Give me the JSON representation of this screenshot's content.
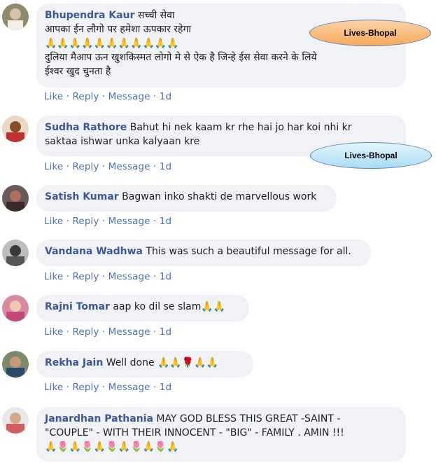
{
  "actions": {
    "like": "Like",
    "reply": "Reply",
    "message": "Message",
    "sep": "·"
  },
  "watermarks": [
    "Lives-Bhopal",
    "Lives-Bhopal"
  ],
  "comments": [
    {
      "name": "Bhupendra Kaur",
      "lines": [
        "सच्ची सेवा",
        "आपका ईन लौगो पर हमेशा ऊपकार रहेगा",
        "🙏🙏🙏🙏🙏🙏🙏🙏🙏🙏🙏",
        "दुलिया मैआप ऊन खुशकिस्मत लोगो मे से ऐक है जिन्हे ईस सेवा करने के लिये",
        "ईश्वर खुद चुनता है"
      ],
      "time": "1d"
    },
    {
      "name": "Sudha Rathore",
      "lines": [
        "Bahut hi nek kaam kr rhe hai jo har koi nhi kr",
        "saktaa ishwar unka kalyaan kre"
      ],
      "time": "1d"
    },
    {
      "name": "Satish Kumar",
      "lines": [
        "Bagwan inko shakti de marvellous work"
      ],
      "time": "1d"
    },
    {
      "name": "Vandana Wadhwa",
      "lines": [
        "This was such a beautiful message for all."
      ],
      "time": "1d"
    },
    {
      "name": "Rajni Tomar",
      "lines": [
        "aap ko dil se slam🙏🙏"
      ],
      "time": "1d"
    },
    {
      "name": "Rekha Jain",
      "lines": [
        "Well done 🙏🙏🌹🙏🙏"
      ],
      "time": "1d"
    },
    {
      "name": "Janardhan Pathania",
      "lines": [
        "MAY GOD BLESS THIS GREAT -SAINT -",
        "\"COUPLE\" - WITH THEIR INNOCENT - \"BIG\" - FAMILY . AMIN !!!",
        "🙏🌷🙏🌷🙏🌷🙏🌷🙏🌷🙏"
      ],
      "time": ""
    }
  ]
}
